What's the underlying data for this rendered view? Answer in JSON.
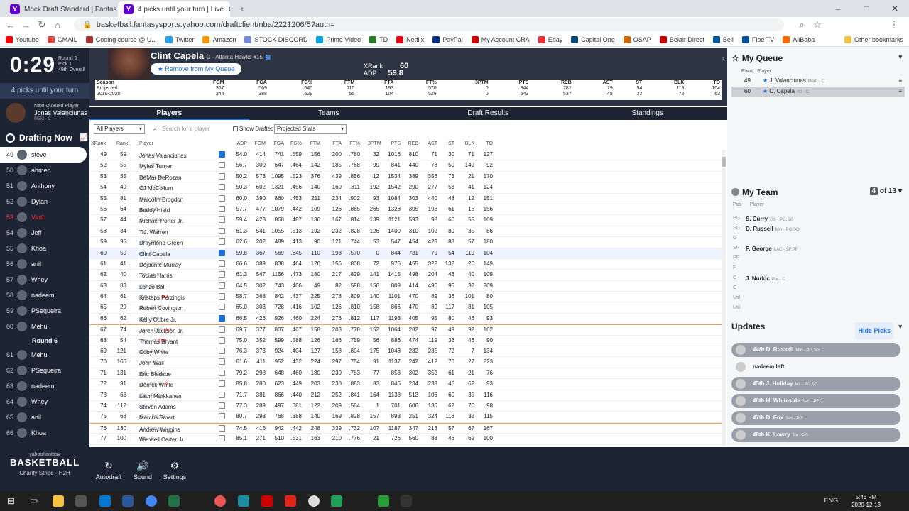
{
  "browser": {
    "tabs": [
      {
        "label": "Mock Draft Standard | Fantasy Ba"
      },
      {
        "label": "4 picks until your turn | Live"
      }
    ],
    "url": "basketball.fantasysports.yahoo.com/draftclient/nba/2221206/5?auth=",
    "bookmarks": [
      "Youtube",
      "GMAIL",
      "Coding course @ U...",
      "Twitter",
      "Amazon",
      "STOCK DISCORD",
      "Prime Video",
      "TD",
      "Netflix",
      "PayPal",
      "My Account CRA",
      "Ebay",
      "Capital One",
      "OSAP",
      "Belair Direct",
      "Bell",
      "Fibe TV",
      "AliBaba",
      "Other bookmarks"
    ]
  },
  "timer": {
    "time": "0:29",
    "round": "Round 5",
    "pick": "Pick 1",
    "overall": "49th Overall"
  },
  "picks_until": "4 picks until your turn",
  "next_queued": {
    "label": "Next Queued Player",
    "name": "Jonas Valanciunas",
    "team": "MEM - C"
  },
  "drafting_now": "Drafting Now",
  "draft_order": [
    {
      "n": "49",
      "name": "steve",
      "cur": true
    },
    {
      "n": "50",
      "name": "ahmed"
    },
    {
      "n": "51",
      "name": "Anthony"
    },
    {
      "n": "52",
      "name": "Dylan"
    },
    {
      "n": "53",
      "name": "Vinth",
      "me": true
    },
    {
      "n": "54",
      "name": "Jeff"
    },
    {
      "n": "55",
      "name": "Khoa"
    },
    {
      "n": "56",
      "name": "anil"
    },
    {
      "n": "57",
      "name": "Whey"
    },
    {
      "n": "58",
      "name": "nadeem"
    },
    {
      "n": "59",
      "name": "PSequeira"
    },
    {
      "n": "60",
      "name": "Mehul"
    },
    {
      "round": "Round 6"
    },
    {
      "n": "61",
      "name": "Mehul"
    },
    {
      "n": "62",
      "name": "PSequeira"
    },
    {
      "n": "63",
      "name": "nadeem"
    },
    {
      "n": "64",
      "name": "Whey"
    },
    {
      "n": "65",
      "name": "anil"
    },
    {
      "n": "66",
      "name": "Khoa"
    }
  ],
  "brand": {
    "l1": "yahoo!fantasy",
    "l2": "BASKETBALL",
    "l3": "Charity Stripe - H2H"
  },
  "bottom": {
    "autodraft": "Autodraft",
    "sound": "Sound",
    "settings": "Settings"
  },
  "player": {
    "name": "Clint Capela",
    "team": "C - Atlanta Hawks #15",
    "remove": "★ Remove from My Queue",
    "xrank_label": "XRank",
    "xrank": "60",
    "adp_label": "ADP",
    "adp": "59.8"
  },
  "stat_headers": [
    "Season",
    "FGM",
    "FGA",
    "FG%",
    "FTM",
    "FTA",
    "FT%",
    "3PTM",
    "PTS",
    "REB",
    "AST",
    "ST",
    "BLK",
    "TO"
  ],
  "stat_rows": [
    [
      "Projected",
      "367",
      "569",
      ".645",
      "110",
      "193",
      ".570",
      "0",
      "844",
      "781",
      "79",
      "54",
      "119",
      "104"
    ],
    [
      "2019-2020",
      "244",
      "388",
      ".629",
      "55",
      "104",
      ".529",
      "0",
      "543",
      "537",
      "48",
      "33",
      "72",
      "63"
    ]
  ],
  "main_tabs": [
    "Players",
    "Teams",
    "Draft Results",
    "Standings"
  ],
  "filters": {
    "all_players": "All Players",
    "search_placeholder": "Search for a player",
    "show_drafted": "Show Drafted",
    "stats": "Projected Stats"
  },
  "columns": [
    "XRank",
    "Rank",
    "Player",
    "ADP",
    "FGM",
    "FGA",
    "FG%",
    "FTM",
    "FTA",
    "FT%",
    "3PTM",
    "PTS",
    "REB",
    "AST",
    "ST",
    "BLK",
    "TO"
  ],
  "players": [
    {
      "x": "49",
      "r": "59",
      "name": "Jonas Valanciunas",
      "pos": "Mem - C",
      "q": true,
      "s": [
        "54.0",
        "414",
        "741",
        ".559",
        "156",
        "200",
        ".780",
        "32",
        "1016",
        "810",
        "71",
        "30",
        "71",
        "127"
      ]
    },
    {
      "x": "52",
      "r": "55",
      "name": "Myles Turner",
      "pos": "Ind - PF,C",
      "s": [
        "56.7",
        "300",
        "647",
        ".464",
        "142",
        "185",
        ".768",
        "99",
        "841",
        "440",
        "78",
        "50",
        "149",
        "92"
      ]
    },
    {
      "x": "53",
      "r": "35",
      "name": "DeMar DeRozan",
      "pos": "SA - SG,SF",
      "s": [
        "50.2",
        "573",
        "1095",
        ".523",
        "376",
        "439",
        ".856",
        "12",
        "1534",
        "389",
        "356",
        "73",
        "21",
        "170"
      ]
    },
    {
      "x": "54",
      "r": "49",
      "name": "CJ McCollum",
      "pos": "Por - PG,SG",
      "s": [
        "50.3",
        "602",
        "1321",
        ".456",
        "140",
        "160",
        ".811",
        "192",
        "1542",
        "290",
        "277",
        "53",
        "41",
        "124"
      ]
    },
    {
      "x": "55",
      "r": "81",
      "name": "Malcolm Brogdon",
      "pos": "Ind - PG,SG",
      "s": [
        "60.0",
        "390",
        "860",
        ".453",
        "211",
        "234",
        ".902",
        "93",
        "1084",
        "303",
        "440",
        "48",
        "12",
        "151"
      ]
    },
    {
      "x": "56",
      "r": "64",
      "name": "Buddy Hield",
      "pos": "Sac - SG",
      "s": [
        "57.7",
        "477",
        "1079",
        ".442",
        "109",
        "126",
        ".865",
        "265",
        "1328",
        "305",
        "198",
        "61",
        "16",
        "156"
      ]
    },
    {
      "x": "57",
      "r": "44",
      "name": "Michael Porter Jr.",
      "pos": "Den - SF,PF",
      "s": [
        "59.4",
        "423",
        "868",
        ".487",
        "136",
        "167",
        ".814",
        "139",
        "1121",
        "593",
        "98",
        "60",
        "55",
        "109"
      ]
    },
    {
      "x": "58",
      "r": "34",
      "name": "T.J. Warren",
      "pos": "Ind - SF,PF",
      "s": [
        "61.3",
        "541",
        "1055",
        ".513",
        "192",
        "232",
        ".828",
        "126",
        "1400",
        "310",
        "102",
        "80",
        "35",
        "86"
      ]
    },
    {
      "x": "59",
      "r": "95",
      "name": "Draymond Green",
      "pos": "GS - PF,C",
      "s": [
        "62.6",
        "202",
        "489",
        ".413",
        "90",
        "121",
        ".744",
        "53",
        "547",
        "454",
        "423",
        "88",
        "57",
        "180"
      ]
    },
    {
      "x": "60",
      "r": "50",
      "name": "Clint Capela",
      "pos": "Atl - C",
      "q": true,
      "hl": true,
      "s": [
        "59.8",
        "367",
        "569",
        ".645",
        "110",
        "193",
        ".570",
        "0",
        "844",
        "781",
        "79",
        "54",
        "119",
        "104"
      ]
    },
    {
      "x": "61",
      "r": "41",
      "name": "Dejounte Murray",
      "pos": "SA - PG,SG",
      "s": [
        "66.6",
        "389",
        "838",
        ".464",
        "126",
        "156",
        ".808",
        "72",
        "976",
        "455",
        "322",
        "132",
        "20",
        "149"
      ]
    },
    {
      "x": "62",
      "r": "40",
      "name": "Tobias Harris",
      "pos": "Phi - SF,PF",
      "s": [
        "61.3",
        "547",
        "1156",
        ".473",
        "180",
        "217",
        ".829",
        "141",
        "1415",
        "498",
        "204",
        "43",
        "40",
        "105"
      ]
    },
    {
      "x": "63",
      "r": "83",
      "name": "Lonzo Ball",
      "pos": "NO - PG,SG",
      "s": [
        "64.5",
        "302",
        "743",
        ".406",
        "49",
        "82",
        ".598",
        "156",
        "809",
        "414",
        "496",
        "95",
        "32",
        "209"
      ]
    },
    {
      "x": "64",
      "r": "61",
      "name": "Kristaps Porzingis",
      "pos": "Dal - PF,C",
      "inj": "INJ",
      "s": [
        "58.7",
        "368",
        "842",
        ".437",
        "225",
        "278",
        ".809",
        "140",
        "1101",
        "470",
        "89",
        "36",
        "101",
        "80"
      ]
    },
    {
      "x": "65",
      "r": "29",
      "name": "Robert Covington",
      "pos": "Por - SF,PF",
      "s": [
        "65.0",
        "303",
        "728",
        ".416",
        "102",
        "126",
        ".810",
        "158",
        "866",
        "470",
        "89",
        "117",
        "81",
        "105"
      ]
    },
    {
      "x": "66",
      "r": "62",
      "name": "Kelly Oubre Jr.",
      "pos": "GS - SF,PF",
      "q": true,
      "s": [
        "66.5",
        "426",
        "926",
        ".460",
        "224",
        "276",
        ".812",
        "117",
        "1193",
        "405",
        "95",
        "80",
        "46",
        "93"
      ]
    },
    {
      "x": "67",
      "r": "74",
      "name": "Jaren Jackson Jr.",
      "pos": "Mem - PF,C",
      "inj": "INJ",
      "div": true,
      "s": [
        "69.7",
        "377",
        "807",
        ".467",
        "158",
        "203",
        ".778",
        "152",
        "1064",
        "282",
        "97",
        "49",
        "92",
        "102"
      ]
    },
    {
      "x": "68",
      "r": "54",
      "name": "Thomas Bryant",
      "pos": "Was - C",
      "inj": "GTD",
      "s": [
        "75.0",
        "352",
        "599",
        ".588",
        "126",
        "166",
        ".759",
        "56",
        "886",
        "474",
        "119",
        "36",
        "46",
        "90"
      ]
    },
    {
      "x": "69",
      "r": "121",
      "name": "Coby White",
      "pos": "Chi - PG,SG",
      "s": [
        "76.3",
        "373",
        "924",
        ".404",
        "127",
        "158",
        ".804",
        "175",
        "1048",
        "282",
        "235",
        "72",
        "7",
        "134"
      ]
    },
    {
      "x": "70",
      "r": "166",
      "name": "John Wall",
      "pos": "Hou - PG",
      "s": [
        "61.6",
        "411",
        "952",
        ".432",
        "224",
        "297",
        ".754",
        "91",
        "1137",
        "242",
        "412",
        "70",
        "27",
        "223"
      ]
    },
    {
      "x": "71",
      "r": "131",
      "name": "Eric Bledsoe",
      "pos": "NO - PG,SG",
      "s": [
        "79.2",
        "298",
        "648",
        ".460",
        "180",
        "230",
        ".783",
        "77",
        "853",
        "302",
        "352",
        "61",
        "21",
        "76"
      ]
    },
    {
      "x": "72",
      "r": "91",
      "name": "Derrick White",
      "pos": "SA - PG,SG",
      "inj": "O",
      "s": [
        "85.8",
        "280",
        "623",
        ".449",
        "203",
        "230",
        ".883",
        "83",
        "846",
        "234",
        "238",
        "46",
        "62",
        "93"
      ]
    },
    {
      "x": "73",
      "r": "66",
      "name": "Lauri Markkanen",
      "pos": "Chi - PF,C",
      "s": [
        "71.7",
        "381",
        "866",
        ".440",
        "212",
        "252",
        ".841",
        "164",
        "1138",
        "513",
        "106",
        "60",
        "35",
        "116"
      ]
    },
    {
      "x": "74",
      "r": "112",
      "name": "Steven Adams",
      "pos": "NO - C",
      "s": [
        "77.3",
        "289",
        "497",
        ".581",
        "122",
        "209",
        ".584",
        "1",
        "701",
        "606",
        "136",
        "62",
        "70",
        "98"
      ]
    },
    {
      "x": "75",
      "r": "63",
      "name": "Marcus Smart",
      "pos": "Bos - PG,SG",
      "s": [
        "80.7",
        "298",
        "768",
        ".388",
        "140",
        "169",
        ".828",
        "157",
        "893",
        "251",
        "324",
        "113",
        "32",
        "115"
      ]
    },
    {
      "x": "76",
      "r": "130",
      "name": "Andrew Wiggins",
      "pos": "GS - SG,SF",
      "div": true,
      "s": [
        "74.5",
        "416",
        "942",
        ".442",
        "248",
        "339",
        ".732",
        "107",
        "1187",
        "347",
        "213",
        "57",
        "67",
        "167"
      ]
    },
    {
      "x": "77",
      "r": "100",
      "name": "Wendell Carter Jr.",
      "pos": "Chi - C",
      "s": [
        "85.1",
        "271",
        "510",
        ".531",
        "163",
        "210",
        ".776",
        "21",
        "726",
        "560",
        "88",
        "46",
        "69",
        "100"
      ]
    }
  ],
  "queue": {
    "title": "My Queue",
    "rank_h": "Rank",
    "player_h": "Player",
    "items": [
      {
        "r": "49",
        "name": "J. Valanciunas",
        "pos": "Mem - C"
      },
      {
        "r": "60",
        "name": "C. Capela",
        "pos": "Atl - C",
        "on": true
      }
    ]
  },
  "my_team": {
    "title": "My Team",
    "count": "4",
    "of": "of 13",
    "pos_h": "Pos",
    "player_h": "Player",
    "slots": [
      {
        "p": "PG",
        "n": "S. Curry",
        "t": "GS - PG,SG"
      },
      {
        "p": "SG",
        "n": "D. Russell",
        "t": "Min - PG,SG"
      },
      {
        "p": "G",
        "n": ""
      },
      {
        "p": "SF",
        "n": "P. George",
        "t": "LAC - SF,PF"
      },
      {
        "p": "PF",
        "n": ""
      },
      {
        "p": "F",
        "n": ""
      },
      {
        "p": "C",
        "n": "J. Nurkic",
        "t": "Por - C"
      },
      {
        "p": "C",
        "n": ""
      },
      {
        "p": "Util",
        "n": ""
      },
      {
        "p": "Util",
        "n": ""
      }
    ]
  },
  "updates": {
    "title": "Updates",
    "hide": "Hide Picks",
    "items": [
      {
        "t": "44th D. Russell",
        "pos": "Min - PG,SG"
      },
      {
        "t": "nadeem left",
        "plain": true
      },
      {
        "t": "45th J. Holiday",
        "pos": "Mil - PG,SG"
      },
      {
        "t": "46th H. Whiteside",
        "pos": "Sac - PF,C"
      },
      {
        "t": "47th D. Fox",
        "pos": "Sac - PG"
      },
      {
        "t": "48th K. Lowry",
        "pos": "Tor - PG"
      }
    ]
  },
  "clock": {
    "time": "5:46 PM",
    "date": "2020-12-13",
    "lang": "ENG"
  }
}
